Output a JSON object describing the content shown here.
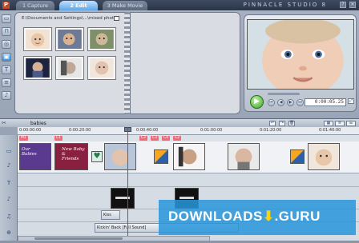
{
  "app": {
    "logo_letter": "P",
    "brand": "PINNACLE STUDIO 8",
    "tabs": [
      {
        "label": "1 Capture",
        "active": false
      },
      {
        "label": "2 Edit",
        "active": true
      },
      {
        "label": "3 Make Movie",
        "active": false
      }
    ],
    "window_buttons": [
      "?",
      "×"
    ]
  },
  "tools": [
    {
      "icon": "camera-icon"
    },
    {
      "icon": "folder-icon"
    },
    {
      "icon": "camera-icon"
    },
    {
      "icon": "photo-icon"
    },
    {
      "icon": "title-icon"
    },
    {
      "icon": "transition-icon"
    },
    {
      "icon": "sound-icon"
    }
  ],
  "album": {
    "path": "E:\\Documents and Settings\\...\\mixed photos",
    "thumbnails": [
      {
        "tone": "#e8c7a8"
      },
      {
        "tone": "#d9b28f"
      },
      {
        "tone": "#cdb99a"
      },
      {
        "tone": "#4a5a8a"
      },
      {
        "tone": "#d8d0c8"
      },
      {
        "tone": "#e2c3ad"
      }
    ]
  },
  "preview": {
    "timecode": "0:00:05.25"
  },
  "timeline": {
    "project_name": "babies",
    "ruler": [
      "0:00:00:00",
      "0:00:20:00",
      "0:00:40:00",
      "0:01:00:00",
      "0:01:20:00",
      "0:01:40:00"
    ],
    "markers": [
      "M1",
      "C1",
      "C2",
      "C3",
      "C4",
      "C2"
    ],
    "title_clips": [
      {
        "text": "Our\nBabies",
        "color": "#5a3a8e"
      },
      {
        "text": "New Baby\n&\nFriends",
        "color": "#8a2040"
      }
    ],
    "sound_clips": [
      "Kiss",
      "Kickin' Back [Full Sound]"
    ]
  },
  "watermark": {
    "text_left": "DOWNLOADS",
    "arrow": "⬇",
    "text_right": ".GURU"
  }
}
